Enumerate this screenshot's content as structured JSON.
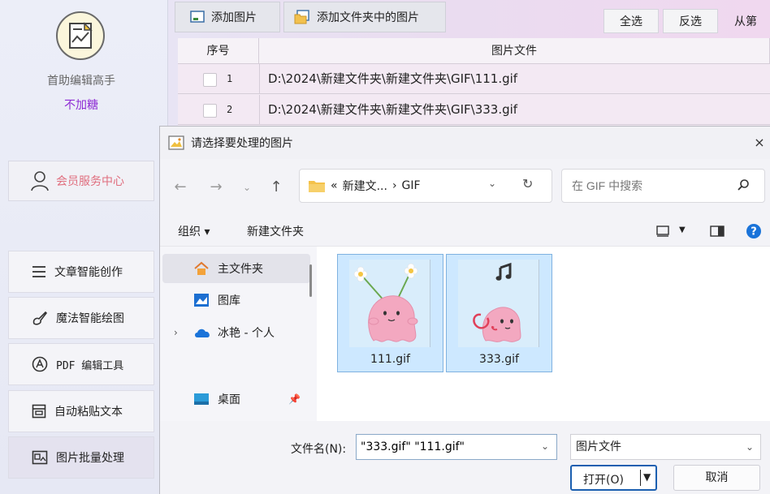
{
  "sidebar": {
    "app_name": "首助编辑高手",
    "slogan": "不加糖",
    "member": "会员服务中心",
    "items": [
      {
        "label": "文章智能创作",
        "icon": "list-icon"
      },
      {
        "label": "魔法智能绘图",
        "icon": "brush-icon"
      },
      {
        "label": "PDF 编辑工具",
        "icon": "pdf-icon"
      },
      {
        "label": "自动粘贴文本",
        "icon": "paste-icon"
      },
      {
        "label": "图片批量处理",
        "icon": "image-batch-icon"
      }
    ]
  },
  "toolbar": {
    "add_image": "添加图片",
    "add_folder": "添加文件夹中的图片",
    "select_all": "全选",
    "invert": "反选",
    "from_prefix": "从第"
  },
  "table": {
    "headers": [
      "序号",
      "图片文件"
    ],
    "rows": [
      {
        "index": "1",
        "path": "D:\\2024\\新建文件夹\\新建文件夹\\GIF\\111.gif"
      },
      {
        "index": "2",
        "path": "D:\\2024\\新建文件夹\\新建文件夹\\GIF\\333.gif"
      }
    ]
  },
  "dialog": {
    "title": "请选择要处理的图片",
    "close": "×",
    "address": {
      "prefix": "«",
      "seg1": "新建文...",
      "sep": "›",
      "seg2": "GIF"
    },
    "search_placeholder": "在 GIF 中搜索",
    "organize": "组织 ▾",
    "new_folder": "新建文件夹",
    "nav": [
      {
        "label": "主文件夹",
        "selected": true
      },
      {
        "label": "图库"
      },
      {
        "label": "冰艳 - 个人"
      },
      {
        "label": "桌面"
      }
    ],
    "files": [
      {
        "name": "111.gif"
      },
      {
        "name": "333.gif"
      }
    ],
    "filename_label": "文件名(N):",
    "filename_value": "\"333.gif\" \"111.gif\"",
    "filetype": "图片文件",
    "open": "打开(O)",
    "cancel": "取消"
  },
  "colors": {
    "accent": "#1b5fb0",
    "slogan": "#8e2bd4",
    "member": "#e06e7e",
    "selection": "#cde8ff"
  }
}
